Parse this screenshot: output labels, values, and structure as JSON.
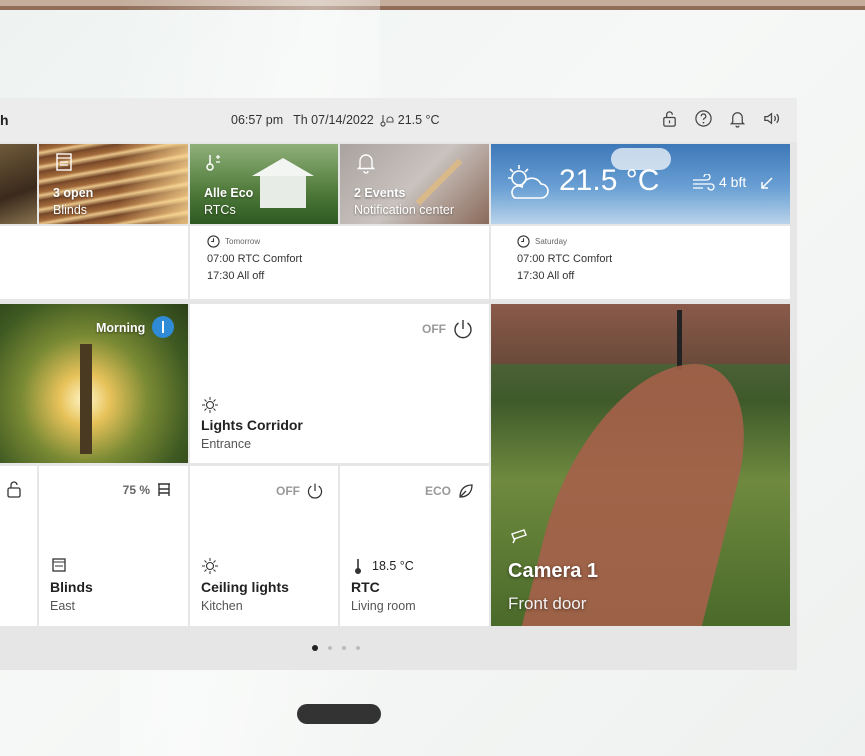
{
  "status": {
    "title_fragment": "h",
    "time": "06:57 pm",
    "date": "Th 07/14/2022",
    "temperature": "21.5 °C",
    "icons": [
      "lock-icon",
      "help-icon",
      "bell-icon",
      "speaker-icon"
    ]
  },
  "top_tiles": {
    "blinds": {
      "line1": "3 open",
      "line2": "Blinds"
    },
    "rtcs": {
      "line1": "Alle Eco",
      "line2": "RTCs"
    },
    "notifications": {
      "line1": "2 Events",
      "line2": "Notification center"
    },
    "weather": {
      "temp": "21.5 °C",
      "wind": "4 bft"
    }
  },
  "schedules": [
    {
      "day": "Tomorrow",
      "line1": "07:00 RTC Comfort",
      "line2": "17:30 All off"
    },
    {
      "day": "Saturday",
      "line1": "07:00 RTC Comfort",
      "line2": "17:30 All off"
    }
  ],
  "scene": {
    "label": "Morning"
  },
  "lights_corridor": {
    "state": "OFF",
    "name": "Lights Corridor",
    "room": "Entrance"
  },
  "blinds_east": {
    "percent": "75 %",
    "name": "Blinds",
    "room": "East"
  },
  "ceiling_lights": {
    "state": "OFF",
    "name": "Ceiling lights",
    "room": "Kitchen"
  },
  "rtc": {
    "mode": "ECO",
    "temp": "18.5 °C",
    "name": "RTC",
    "room": "Living room"
  },
  "camera": {
    "name": "Camera 1",
    "location": "Front door"
  },
  "pager": {
    "count": 4,
    "active": 0
  },
  "colors": {
    "accent_blue": "#2f8bd6",
    "screen_bg": "#e6e6e6",
    "frame_top": "#8f6d59"
  }
}
